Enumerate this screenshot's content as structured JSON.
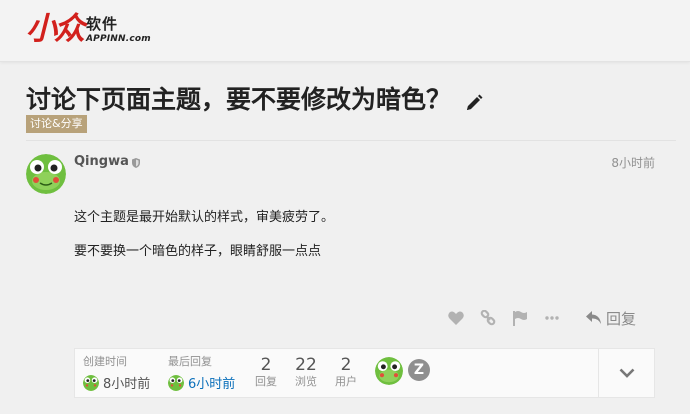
{
  "header": {
    "logo_mark": "小众",
    "logo_cn": "软件",
    "logo_en": "APPINN.com"
  },
  "topic": {
    "title": "讨论下页面主题，要不要修改为暗色？",
    "category": "讨论&分享"
  },
  "post": {
    "username": "Qingwa",
    "date": "8小时前",
    "paragraphs": [
      "这个主题是最开始默认的样式，审美疲劳了。",
      "要不要换一个暗色的样子，眼睛舒服一点点"
    ],
    "reply_label": "回复"
  },
  "topic_map": {
    "created_label": "创建时间",
    "created_value": "8小时前",
    "last_reply_label": "最后回复",
    "last_reply_value": "6小时前",
    "replies_count": "2",
    "replies_label": "回复",
    "views_count": "22",
    "views_label": "浏览",
    "users_count": "2",
    "users_label": "用户",
    "participant_letter": "Z"
  },
  "colors": {
    "brand_red": "#d2201c",
    "category": "#b8a27a",
    "link_blue": "#0a6fba"
  }
}
